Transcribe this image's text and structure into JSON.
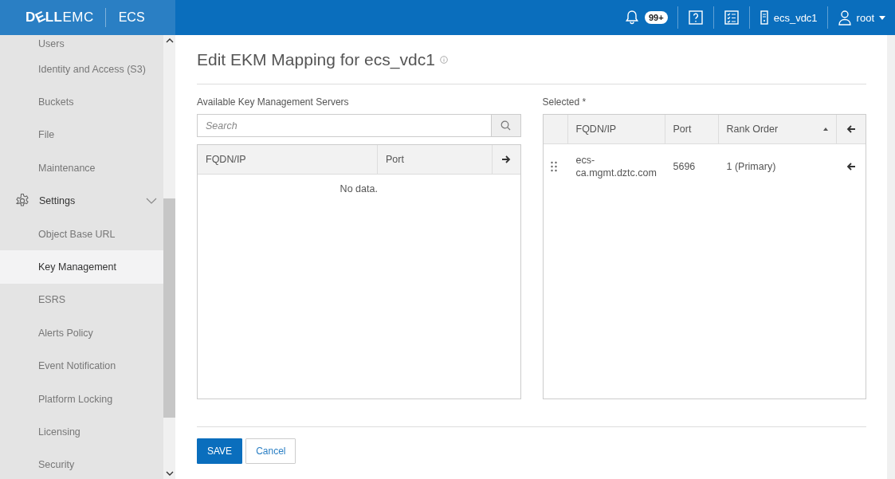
{
  "header": {
    "logo": {
      "brand_left": "D",
      "brand_e": "E",
      "brand_right": "LL",
      "brand_suffix": "EMC"
    },
    "product": "ECS",
    "notifications": {
      "badge": "99+"
    },
    "vdc": "ecs_vdc1",
    "user": "root"
  },
  "sidebar": {
    "items": [
      {
        "label": "Users",
        "selected": false,
        "kind": "link"
      },
      {
        "label": "Identity and Access (S3)",
        "selected": false,
        "kind": "link"
      },
      {
        "label": "Buckets",
        "selected": false,
        "kind": "link"
      },
      {
        "label": "File",
        "selected": false,
        "kind": "link"
      },
      {
        "label": "Maintenance",
        "selected": false,
        "kind": "link"
      },
      {
        "label": "Settings",
        "selected": false,
        "kind": "section",
        "expanded": true
      },
      {
        "label": "Object Base URL",
        "selected": false,
        "kind": "link"
      },
      {
        "label": "Key Management",
        "selected": true,
        "kind": "link"
      },
      {
        "label": "ESRS",
        "selected": false,
        "kind": "link"
      },
      {
        "label": "Alerts Policy",
        "selected": false,
        "kind": "link"
      },
      {
        "label": "Event Notification",
        "selected": false,
        "kind": "link"
      },
      {
        "label": "Platform Locking",
        "selected": false,
        "kind": "link"
      },
      {
        "label": "Licensing",
        "selected": false,
        "kind": "link"
      },
      {
        "label": "Security",
        "selected": false,
        "kind": "link"
      }
    ]
  },
  "page": {
    "title": "Edit EKM Mapping for ecs_vdc1",
    "available": {
      "label": "Available Key Management Servers",
      "search": {
        "placeholder": "Search"
      },
      "columns": [
        "FQDN/IP",
        "Port"
      ],
      "empty_text": "No data."
    },
    "selected": {
      "label": "Selected *",
      "columns": [
        "FQDN/IP",
        "Port",
        "Rank Order"
      ],
      "rows": [
        {
          "fqdn": "ecs-ca.mgmt.dztc.com",
          "port": "5696",
          "rank": "1 (Primary)"
        }
      ]
    },
    "buttons": [
      {
        "label": "SAVE",
        "kind": "primary"
      },
      {
        "label": "Cancel",
        "kind": "secondary"
      }
    ]
  }
}
